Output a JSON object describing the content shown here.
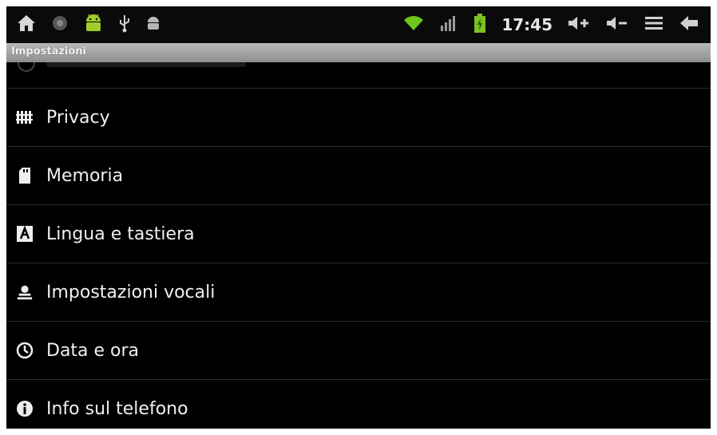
{
  "status_bar": {
    "left_icons": [
      "home-icon",
      "camera-icon",
      "android-icon",
      "usb-icon",
      "android-debug-icon"
    ],
    "right_icons": [
      "wifi-icon",
      "signal-icon",
      "battery-icon"
    ],
    "time": "17:45",
    "controls": [
      "volume-up-icon",
      "volume-down-icon",
      "menu-icon",
      "back-icon"
    ]
  },
  "title": "Impostazioni",
  "settings": {
    "items": [
      {
        "label": "Privacy",
        "icon": "privacy-icon"
      },
      {
        "label": "Memoria",
        "icon": "memory-card-icon"
      },
      {
        "label": "Lingua e tastiera",
        "icon": "keyboard-language-icon"
      },
      {
        "label": "Impostazioni vocali",
        "icon": "voice-settings-icon"
      },
      {
        "label": "Data e ora",
        "icon": "clock-icon"
      },
      {
        "label": "Info sul telefono",
        "icon": "info-icon"
      }
    ]
  },
  "colors": {
    "background": "#000000",
    "text": "#f0f0f0",
    "wifi": "#6cc518",
    "battery": "#79c21f",
    "titlebar": "#a6a6a6"
  }
}
